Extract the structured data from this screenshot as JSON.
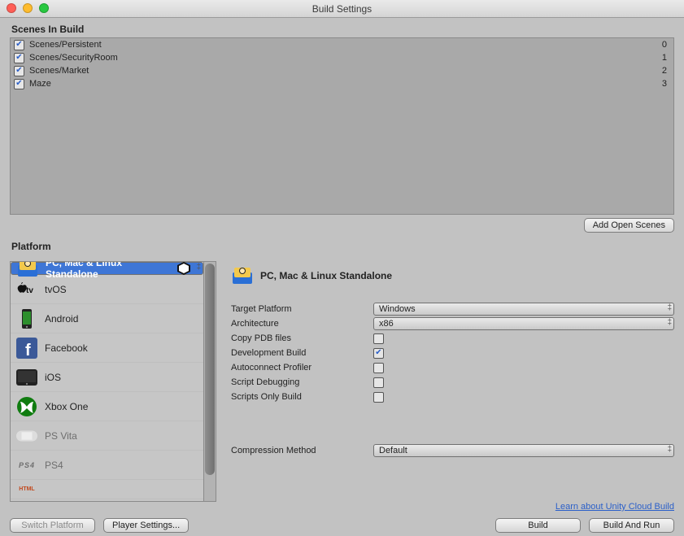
{
  "window": {
    "title": "Build Settings"
  },
  "scenes": {
    "header": "Scenes In Build",
    "items": [
      {
        "checked": true,
        "name": "Scenes/Persistent",
        "index": "0"
      },
      {
        "checked": true,
        "name": "Scenes/SecurityRoom",
        "index": "1"
      },
      {
        "checked": true,
        "name": "Scenes/Market",
        "index": "2"
      },
      {
        "checked": true,
        "name": "Maze",
        "index": "3"
      }
    ],
    "add_button": "Add Open Scenes"
  },
  "platform": {
    "header": "Platform",
    "items": [
      {
        "id": "standalone",
        "label": "PC, Mac & Linux Standalone",
        "selected": true,
        "unity_logo": true
      },
      {
        "id": "tvos",
        "label": "tvOS"
      },
      {
        "id": "android",
        "label": "Android"
      },
      {
        "id": "facebook",
        "label": "Facebook"
      },
      {
        "id": "ios",
        "label": "iOS"
      },
      {
        "id": "xboxone",
        "label": "Xbox One"
      },
      {
        "id": "psvita",
        "label": "PS Vita",
        "dim": true
      },
      {
        "id": "ps4",
        "label": "PS4",
        "dim": true
      },
      {
        "id": "html",
        "label": "",
        "dim": true
      }
    ]
  },
  "detail": {
    "title": "PC, Mac & Linux Standalone",
    "options": {
      "target_platform": {
        "label": "Target Platform",
        "value": "Windows"
      },
      "architecture": {
        "label": "Architecture",
        "value": "x86"
      },
      "copy_pdb": {
        "label": "Copy PDB files",
        "checked": false
      },
      "dev_build": {
        "label": "Development Build",
        "checked": true
      },
      "autoconnect": {
        "label": "Autoconnect Profiler",
        "checked": false
      },
      "script_debug": {
        "label": "Script Debugging",
        "checked": false
      },
      "scripts_only": {
        "label": "Scripts Only Build",
        "checked": false
      },
      "compression": {
        "label": "Compression Method",
        "value": "Default"
      }
    },
    "cloud_link": "Learn about Unity Cloud Build"
  },
  "footer": {
    "switch_platform": "Switch Platform",
    "player_settings": "Player Settings...",
    "build": "Build",
    "build_and_run": "Build And Run"
  }
}
